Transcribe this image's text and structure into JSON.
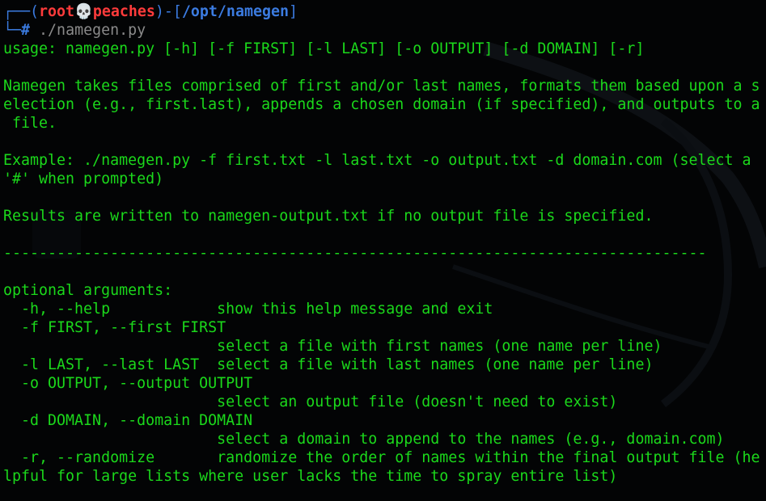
{
  "prompt": {
    "frame_open": "┌──(",
    "user": "root",
    "skull": "💀",
    "host": "peaches",
    "frame_mid": ")-[",
    "path": "/opt/namegen",
    "frame_close": "]",
    "frame_bottom": "└─",
    "hash": "#",
    "command": "./namegen.py"
  },
  "output": {
    "usage": "usage: namegen.py [-h] [-f FIRST] [-l LAST] [-o OUTPUT] [-d DOMAIN] [-r]",
    "desc1": "Namegen takes files comprised of first and/or last names, formats them based upon a s",
    "desc2": "election (e.g., first.last), appends a chosen domain (if specified), and outputs to a",
    "desc3": " file.",
    "example1": "Example: ./namegen.py -f first.txt -l last.txt -o output.txt -d domain.com (select a",
    "example2": "'#' when prompted)",
    "results": "Results are written to namegen-output.txt if no output file is specified.",
    "separator": "-------------------------------------------------------------------------------",
    "optional_header": "optional arguments:",
    "opt_help": "  -h, --help            show this help message and exit",
    "opt_first": "  -f FIRST, --first FIRST",
    "opt_first_desc": "                        select a file with first names (one name per line)",
    "opt_last": "  -l LAST, --last LAST  select a file with last names (one name per line)",
    "opt_output": "  -o OUTPUT, --output OUTPUT",
    "opt_output_desc": "                        select an output file (doesn't need to exist)",
    "opt_domain": "  -d DOMAIN, --domain DOMAIN",
    "opt_domain_desc": "                        select a domain to append to the names (e.g., domain.com)",
    "opt_random1": "  -r, --randomize       randomize the order of names within the final output file (he",
    "opt_random2": "lpful for large lists where user lacks the time to spray entire list)"
  },
  "colors": {
    "background": "#030405",
    "text": "#1bd81b",
    "prompt_frame": "#3b7be0",
    "prompt_user": "#ff3b3b",
    "command": "#8a8a8a"
  }
}
